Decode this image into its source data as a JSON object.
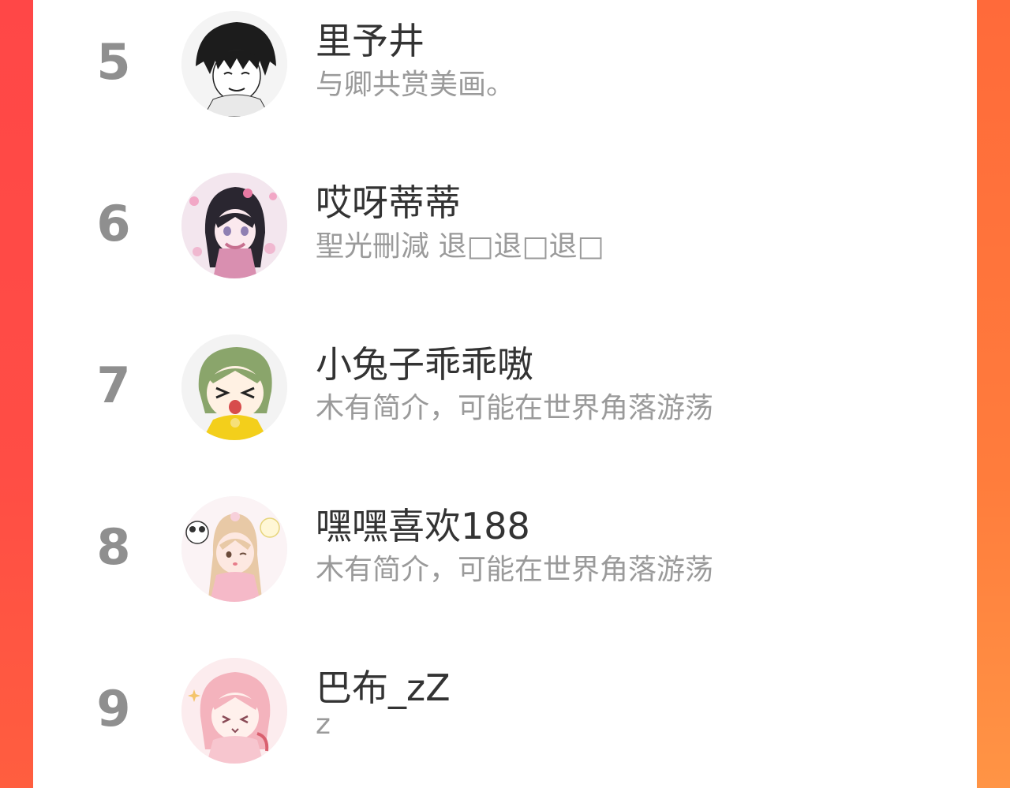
{
  "ranking": {
    "rows": [
      {
        "rank": "5",
        "name": "里予井",
        "bio": "与卿共赏美画。",
        "avatar": "avatar-icon"
      },
      {
        "rank": "6",
        "name": "哎呀蒂蒂",
        "bio": "聖光刪減 退□退□退□",
        "avatar": "avatar-icon"
      },
      {
        "rank": "7",
        "name": "小兔子乖乖嗷",
        "bio": "木有简介，可能在世界角落游荡",
        "avatar": "avatar-icon"
      },
      {
        "rank": "8",
        "name": "嘿嘿喜欢188",
        "bio": "木有简介，可能在世界角落游荡",
        "avatar": "avatar-icon"
      },
      {
        "rank": "9",
        "name": "巴布_zZ",
        "bio": "z",
        "avatar": "avatar-icon"
      }
    ]
  },
  "colors": {
    "background_left": "#ff4a4a",
    "background_right": "#ff8f40",
    "panel": "#ffffff",
    "rank_text": "#8f8f8f",
    "name_text": "#333333",
    "bio_text": "#9a9a9a"
  }
}
